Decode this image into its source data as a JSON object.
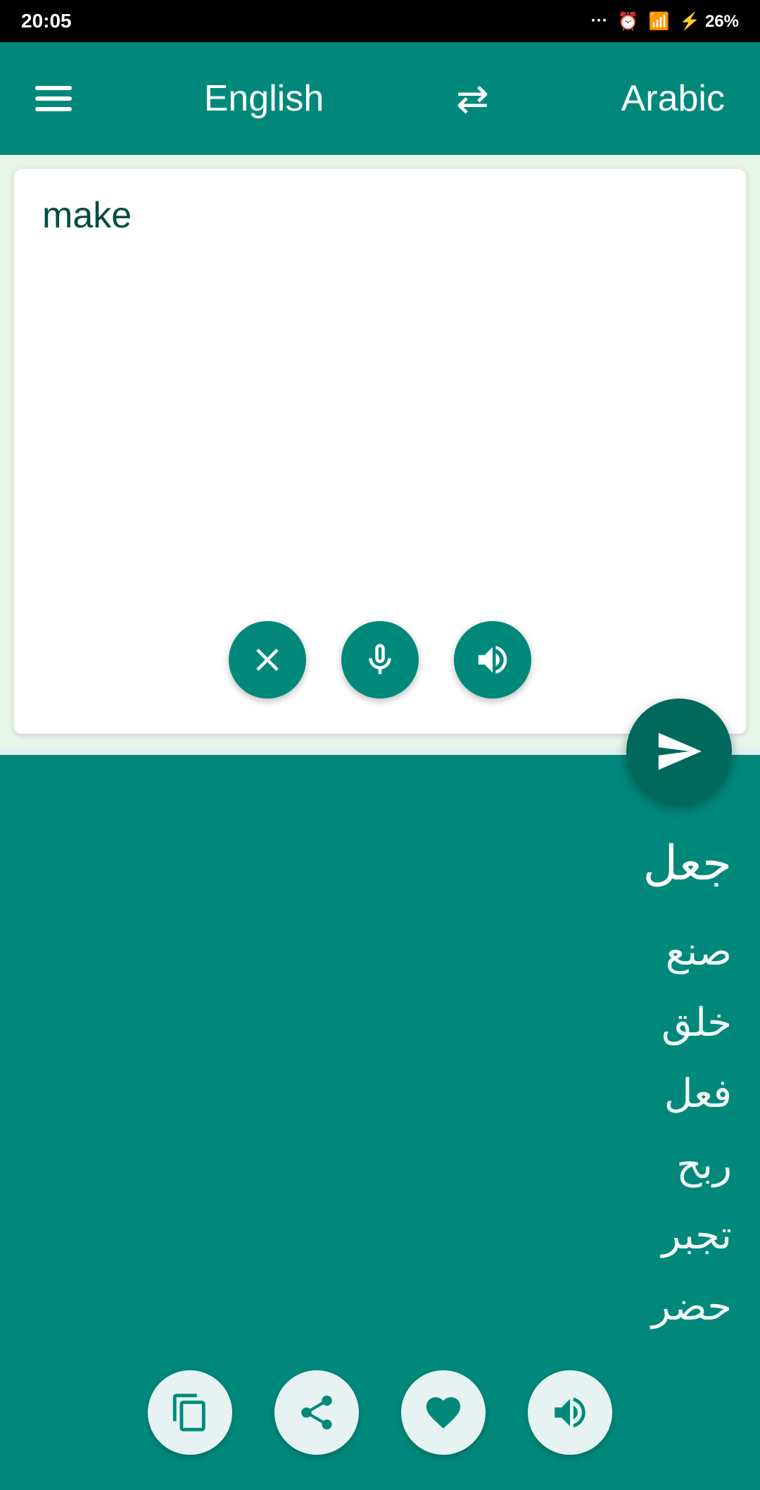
{
  "statusBar": {
    "time": "20:05",
    "battery": "26%"
  },
  "header": {
    "menuLabel": "menu",
    "sourceLang": "English",
    "swapLabel": "swap languages",
    "targetLang": "Arabic"
  },
  "inputArea": {
    "inputText": "make",
    "placeholder": "Enter text",
    "clearLabel": "clear",
    "micLabel": "microphone",
    "speakLabel": "speak"
  },
  "translateBtn": {
    "label": "translate"
  },
  "translationArea": {
    "mainTranslation": "جعل",
    "alternatives": "صنع\nخلق\nفعل\nربح\nتجبر\nحضر",
    "copyLabel": "copy",
    "shareLabel": "share",
    "favoriteLabel": "favorite",
    "listenLabel": "listen"
  }
}
